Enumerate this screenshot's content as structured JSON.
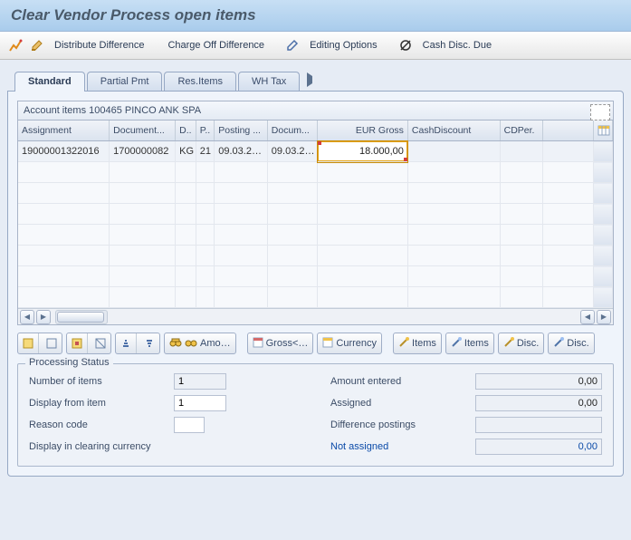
{
  "title": "Clear Vendor Process open items",
  "toolbar1": {
    "distribute_difference": "Distribute Difference",
    "charge_off_difference": "Charge Off Difference",
    "editing_options": "Editing Options",
    "cash_disc_due": "Cash Disc. Due"
  },
  "tabs": {
    "standard": "Standard",
    "partial_pmt": "Partial Pmt",
    "res_items": "Res.Items",
    "wh_tax": "WH Tax"
  },
  "grid": {
    "title": "Account items 100465 PINCO ANK SPA",
    "headers": {
      "assignment": "Assignment",
      "document": "Document...",
      "d": "D..",
      "p": "P..",
      "posting": "Posting ...",
      "docum": "Docum...",
      "eur_gross": "EUR Gross",
      "cash_discount": "CashDiscount",
      "cdper": "CDPer."
    },
    "rows": [
      {
        "assignment": "19000001322016",
        "document": "1700000082",
        "d": "KG",
        "p": "21",
        "posting": "09.03.2…",
        "docum": "09.03.2…",
        "eur_gross": "18.000,00",
        "cash_discount": "",
        "cdper": ""
      }
    ]
  },
  "button_row": {
    "amo": "Amo…",
    "gross": "Gross<…",
    "currency": "Currency",
    "items1": "Items",
    "items2": "Items",
    "disc1": "Disc.",
    "disc2": "Disc."
  },
  "processing": {
    "legend": "Processing Status",
    "number_of_items_lbl": "Number of items",
    "number_of_items_val": "1",
    "display_from_item_lbl": "Display from item",
    "display_from_item_val": "1",
    "reason_code_lbl": "Reason code",
    "reason_code_val": "",
    "display_in_clearing_currency_lbl": "Display in clearing currency",
    "amount_entered_lbl": "Amount entered",
    "amount_entered_val": "0,00",
    "assigned_lbl": "Assigned",
    "assigned_val": "0,00",
    "difference_postings_lbl": "Difference postings",
    "difference_postings_val": "",
    "not_assigned_lbl": "Not assigned",
    "not_assigned_val": "0,00"
  }
}
